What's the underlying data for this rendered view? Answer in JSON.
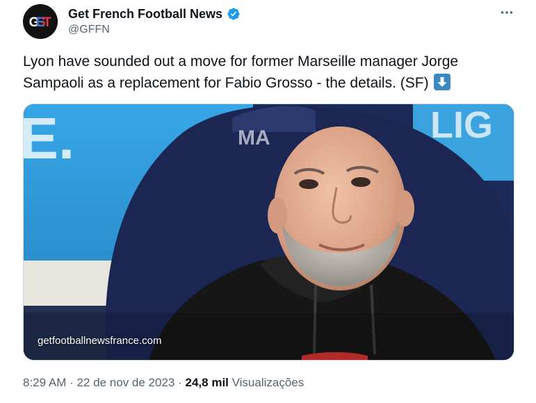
{
  "author": {
    "avatar_text": "GET",
    "display_name": "Get French Football News",
    "handle": "@GFFN",
    "verified_icon": "verified-badge-icon",
    "verified_color": "#1d9bf0"
  },
  "tweet": {
    "text": "Lyon have sounded out a move for former Marseille manager Jorge Sampaoli as a replacement for Fabio Grosso - the details. (SF)",
    "emoji": "down-arrow-emoji"
  },
  "media": {
    "caption": "getfootballnewsfrance.com"
  },
  "meta": {
    "time": "8:29 AM",
    "separator": "·",
    "date": "22 de nov de 2023",
    "views_count": "24,8 mil",
    "views_label": "Visualizações"
  },
  "menu": {
    "more_icon": "more-horizontal-icon"
  },
  "colors": {
    "text_primary": "#0f1419",
    "text_secondary": "#536471",
    "accent": "#1d9bf0"
  }
}
